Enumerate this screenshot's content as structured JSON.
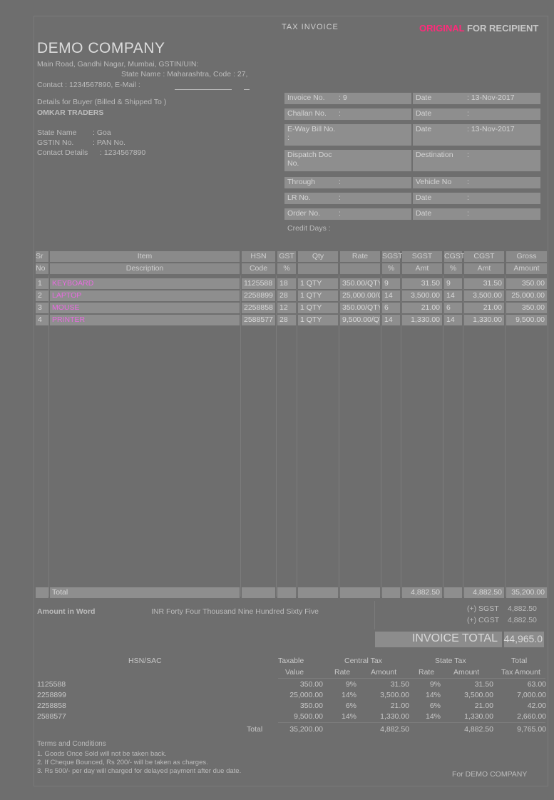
{
  "header": {
    "doc_title": "TAX INVOICE",
    "copy_label_part1": "ORIGINAL",
    "copy_label_part2": "FOR RECIPIENT"
  },
  "seller": {
    "name": "DEMO COMPANY",
    "address_line": "Main Road, Gandhi Nagar, Mumbai, GSTIN/UIN:",
    "state_line": "State Name : Maharashtra, Code : 27,",
    "contact_line": "Contact : 1234567890, E-Mail :"
  },
  "buyer": {
    "heading": "Details for Buyer (Billed & Shipped To )",
    "name": "OMKAR TRADERS",
    "state_label": "State Name",
    "state_value": ": Goa",
    "gstin_label": "GSTIN No.",
    "gstin_value": ": PAN No.",
    "contact_label": "Contact Details",
    "contact_value": ": 1234567890"
  },
  "invoice_meta": [
    {
      "label": "Invoice No.",
      "value": ": 9",
      "date_label": "Date",
      "date_value": ": 13-Nov-2017"
    },
    {
      "label": "Challan No.",
      "value": ":",
      "date_label": "Date",
      "date_value": ":"
    },
    {
      "label": "E-Way Bill No.",
      "value": ":",
      "date_label": "Date",
      "date_value": ": 13-Nov-2017"
    },
    {
      "label": "Dispatch Doc No.",
      "value": "",
      "date_label": "Destination",
      "date_value": ":"
    },
    {
      "label": "Through",
      "value": ":",
      "date_label": "Vehicle No",
      "date_value": ":"
    },
    {
      "label": "LR No.",
      "value": ":",
      "date_label": "Date",
      "date_value": ":"
    },
    {
      "label": "Order No.",
      "value": ":",
      "date_label": "Date",
      "date_value": ":"
    }
  ],
  "credit_days": "Credit Days   :",
  "items_table": {
    "header_row1": [
      "Sr",
      "Item",
      "HSN",
      "GST",
      "Qty",
      "Rate",
      "SGST",
      "SGST",
      "CGST",
      "CGST",
      "Gross"
    ],
    "header_row2": [
      "No",
      "Description",
      "Code",
      "%",
      "",
      "",
      "%",
      "Amt",
      "%",
      "Amt",
      "Amount"
    ],
    "rows": [
      {
        "sr": "1",
        "item": "KEYBOARD",
        "hsn": "1125588",
        "gst": "18",
        "qty": "1 QTY",
        "rate": "350.00/QTY",
        "sgst_pct": "9",
        "sgst_amt": "31.50",
        "cgst_pct": "9",
        "cgst_amt": "31.50",
        "gross": "350.00"
      },
      {
        "sr": "2",
        "item": "LAPTOP",
        "hsn": "2258899",
        "gst": "28",
        "qty": "1 QTY",
        "rate": "25,000.00/QTY",
        "sgst_pct": "14",
        "sgst_amt": "3,500.00",
        "cgst_pct": "14",
        "cgst_amt": "3,500.00",
        "gross": "25,000.00"
      },
      {
        "sr": "3",
        "item": "MOUSE",
        "hsn": "2258858",
        "gst": "12",
        "qty": "1 QTY",
        "rate": "350.00/QTY",
        "sgst_pct": "6",
        "sgst_amt": "21.00",
        "cgst_pct": "6",
        "cgst_amt": "21.00",
        "gross": "350.00"
      },
      {
        "sr": "4",
        "item": "PRINTER",
        "hsn": "2588577",
        "gst": "28",
        "qty": "1 QTY",
        "rate": "9,500.00/QTY",
        "sgst_pct": "14",
        "sgst_amt": "1,330.00",
        "cgst_pct": "14",
        "cgst_amt": "1,330.00",
        "gross": "9,500.00"
      }
    ],
    "total_label": "Total",
    "total_sgst": "4,882.50",
    "total_cgst": "4,882.50",
    "total_gross": "35,200.00"
  },
  "amount_words": {
    "label": "Amount in Word",
    "value": "INR Forty Four Thousand Nine Hundred  Sixty Five"
  },
  "tax_summary_right": {
    "sgst_label": "(+) SGST",
    "sgst_value": "4,882.50",
    "cgst_label": "(+) CGST",
    "cgst_value": "4,882.50"
  },
  "invoice_total": {
    "label": "INVOICE TOTAL",
    "value": "44,965.0"
  },
  "hsn_table": {
    "headers": {
      "hsn": "HSN/SAC",
      "taxable": "Taxable",
      "taxable2": "Value",
      "central": "Central Tax",
      "central_rate": "Rate",
      "central_amt": "Amount",
      "state": "State Tax",
      "state_rate": "Rate",
      "state_amt": "Amount",
      "total": "Total",
      "total2": "Tax Amount"
    },
    "rows": [
      {
        "hsn": "1125588",
        "taxable": "350.00",
        "c_rate": "9%",
        "c_amt": "31.50",
        "s_rate": "9%",
        "s_amt": "31.50",
        "total": "63.00"
      },
      {
        "hsn": "2258899",
        "taxable": "25,000.00",
        "c_rate": "14%",
        "c_amt": "3,500.00",
        "s_rate": "14%",
        "s_amt": "3,500.00",
        "total": "7,000.00"
      },
      {
        "hsn": "2258858",
        "taxable": "350.00",
        "c_rate": "6%",
        "c_amt": "21.00",
        "s_rate": "6%",
        "s_amt": "21.00",
        "total": "42.00"
      },
      {
        "hsn": "2588577",
        "taxable": "9,500.00",
        "c_rate": "14%",
        "c_amt": "1,330.00",
        "s_rate": "14%",
        "s_amt": "1,330.00",
        "total": "2,660.00"
      }
    ],
    "total_label": "Total",
    "total_taxable": "35,200.00",
    "total_c_amt": "4,882.50",
    "total_s_amt": "4,882.50",
    "total_tax": "9,765.00"
  },
  "terms": {
    "heading": "Terms and Conditions",
    "lines": [
      "1. Goods Once Sold will not be taken back.",
      "2. If Cheque Bounced, Rs 200/- will be taken as charges.",
      "3. Rs 500/- per day will charged for delayed payment after due date."
    ]
  },
  "signatory": "For DEMO COMPANY"
}
